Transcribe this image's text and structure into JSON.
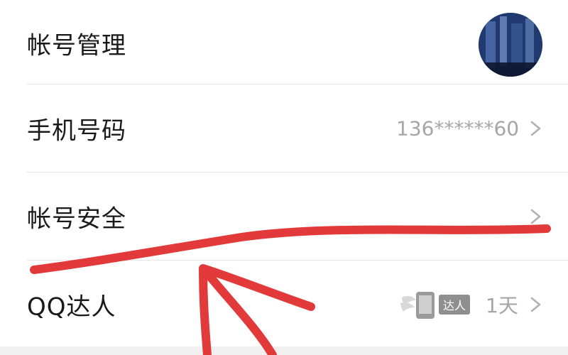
{
  "rows": [
    {
      "label": "帐号管理"
    },
    {
      "label": "手机号码",
      "value": "136******60"
    },
    {
      "label": "帐号安全"
    },
    {
      "label": "QQ达人",
      "badge_text": "达人",
      "value": "1天"
    }
  ],
  "icons": {
    "avatar": "avatar-image",
    "chevron": "chevron-right-icon",
    "badge": "qq-daren-badge-icon"
  },
  "colors": {
    "text": "#1a1a1a",
    "secondary": "#a6a6a6",
    "annotation": "#e23a3a"
  }
}
